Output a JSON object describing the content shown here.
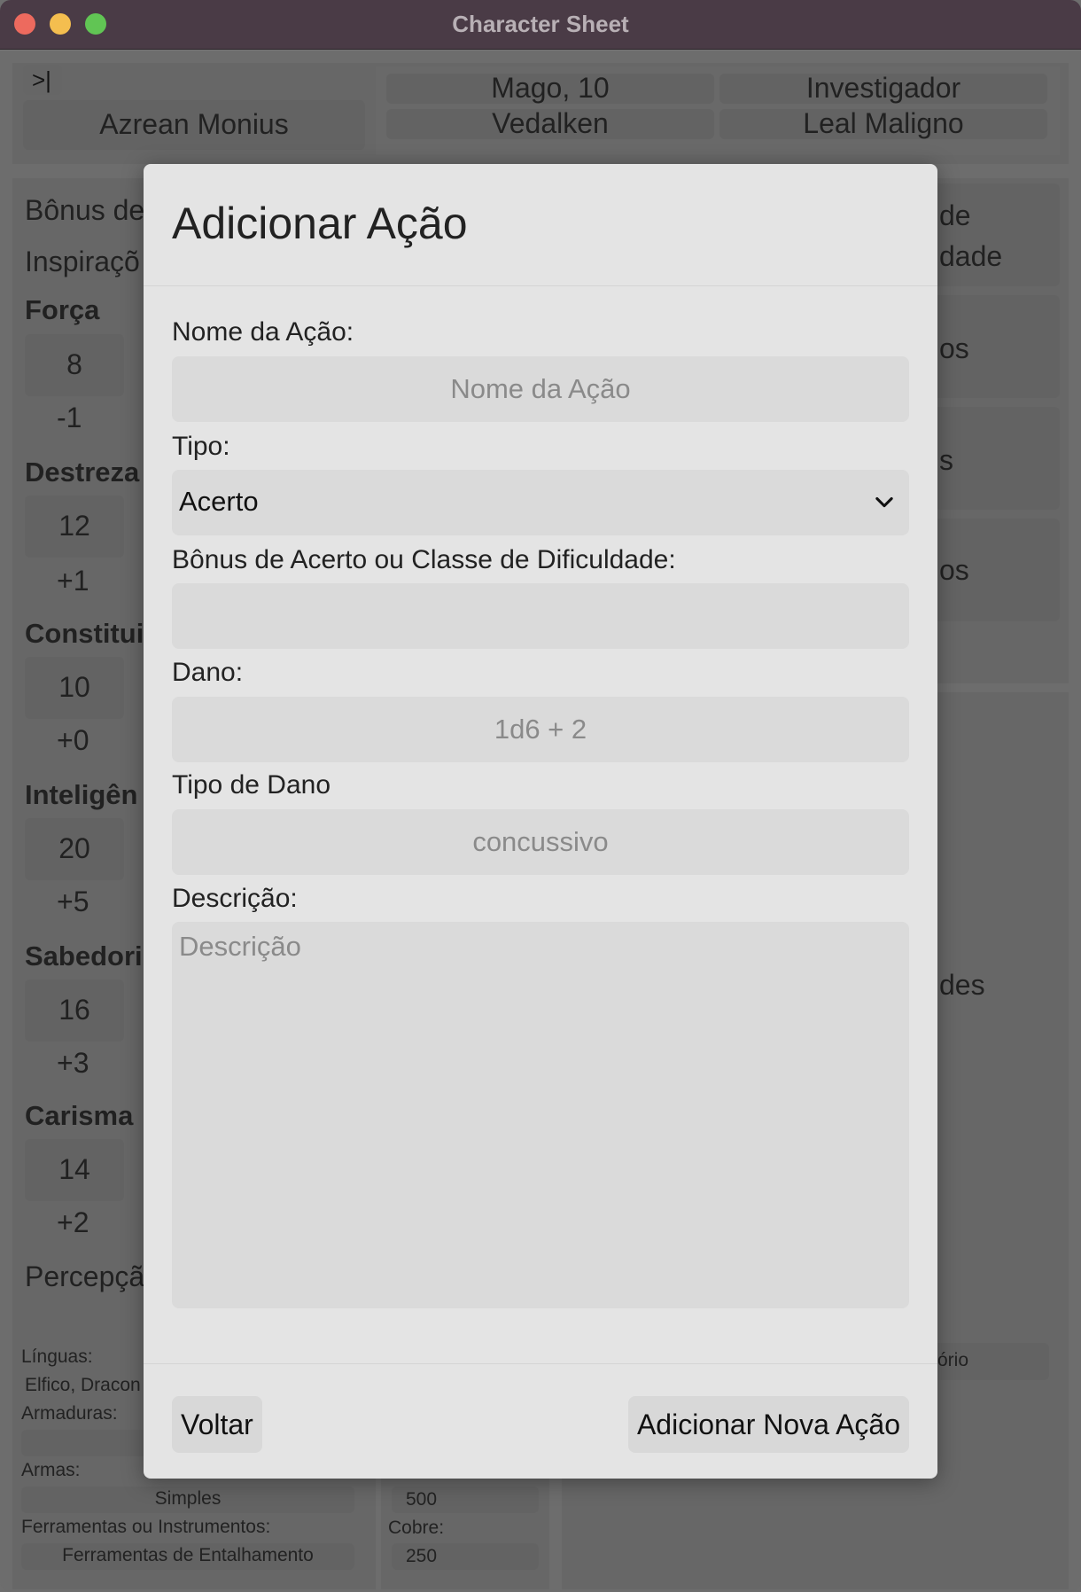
{
  "window": {
    "title": "Character Sheet"
  },
  "sidebar_toggle": {
    "icon": "sidebar-toggle-icon",
    "glyph": ">|"
  },
  "header": {
    "character_name": "Azrean Monius",
    "class_level": "Mago, 10",
    "background": "Investigador",
    "race": "Vedalken",
    "alignment": "Leal Maligno"
  },
  "left_panel": {
    "bonus_label": "Bônus de",
    "inspiration_label": "Inspiraçõ",
    "abilities": [
      {
        "name": "Força",
        "score": "8",
        "mod": "-1"
      },
      {
        "name": "Destreza",
        "score": "12",
        "mod": "+1"
      },
      {
        "name": "Constitui",
        "score": "10",
        "mod": "+0"
      },
      {
        "name": "Inteligên",
        "score": "20",
        "mod": "+5"
      },
      {
        "name": "Sabedori",
        "score": "16",
        "mod": "+3"
      },
      {
        "name": "Carisma",
        "score": "14",
        "mod": "+2"
      }
    ],
    "perception_label": "Percepçã"
  },
  "right_panel": {
    "fragments": [
      "de",
      "dade",
      "os",
      "s",
      "os",
      "des"
    ]
  },
  "bottom": {
    "languages_label": "Línguas:",
    "languages_value": "Elfico, Dracon",
    "armor_label": "Armaduras:",
    "weapons_label": "Armas:",
    "weapons_value": "Simples",
    "tools_label": "Ferramentas ou Instrumentos:",
    "tools_value": "Ferramentas de Entalhamento",
    "coin1_value": "500",
    "copper_label": "Cobre:",
    "copper_value": "250",
    "right_fragment": "ório"
  },
  "modal": {
    "title": "Adicionar Ação",
    "name_label": "Nome da Ação:",
    "name_placeholder": "Nome da Ação",
    "type_label": "Tipo:",
    "type_value": "Acerto",
    "bonus_label": "Bônus de Acerto ou Classe de Dificuldade:",
    "bonus_value": "",
    "damage_label": "Dano:",
    "damage_placeholder": "1d6 + 2",
    "damage_type_label": "Tipo de Dano",
    "damage_type_placeholder": "concussivo",
    "description_label": "Descrição:",
    "description_placeholder": "Descrição",
    "back_label": "Voltar",
    "add_label": "Adicionar Nova Ação"
  },
  "colors": {
    "titlebar": "#4a3b46",
    "modal_bg": "#e4e4e4",
    "field_bg": "#dadada",
    "close": "#ed6a5e",
    "minimize": "#f4be4f",
    "zoom": "#61c554"
  }
}
